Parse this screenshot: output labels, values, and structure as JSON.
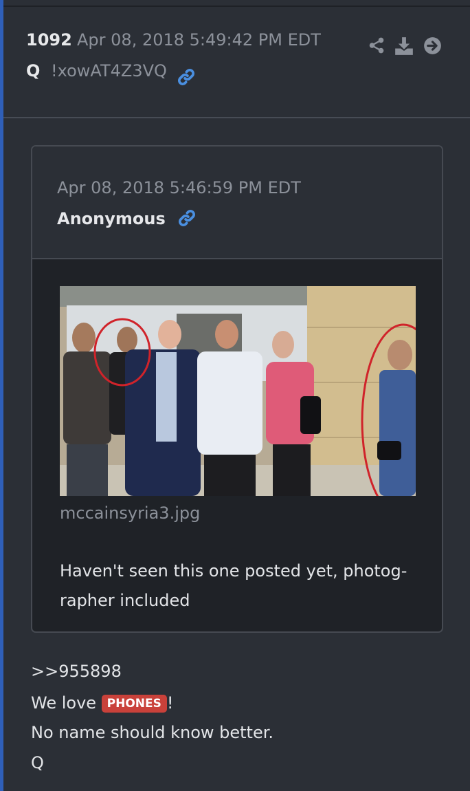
{
  "post": {
    "number": "1092",
    "date": "Apr 08, 2018 5:49:42 PM EDT",
    "author": "Q",
    "tripcode": "!xowAT4Z3VQ",
    "icons": [
      "share-icon",
      "download-icon",
      "arrow-right-circle-icon",
      "link-icon"
    ]
  },
  "quoted": {
    "date": "Apr 08, 2018 5:46:59 PM EDT",
    "author": "Anonymous",
    "filename": "mccainsyria3.jpg",
    "text_line1": "Haven't seen this one posted yet, photog-",
    "text_line2": "rapher included"
  },
  "body": {
    "ref": ">>955898",
    "line2_prefix": "We love ",
    "badge": "PHONES",
    "line2_suffix": "!",
    "line3": "No name should know better.",
    "sign": "Q"
  },
  "colors": {
    "accent": "#2f5fb8",
    "link_icon": "#4a8fe0",
    "badge": "#c9413a",
    "background": "#2b2f36"
  }
}
